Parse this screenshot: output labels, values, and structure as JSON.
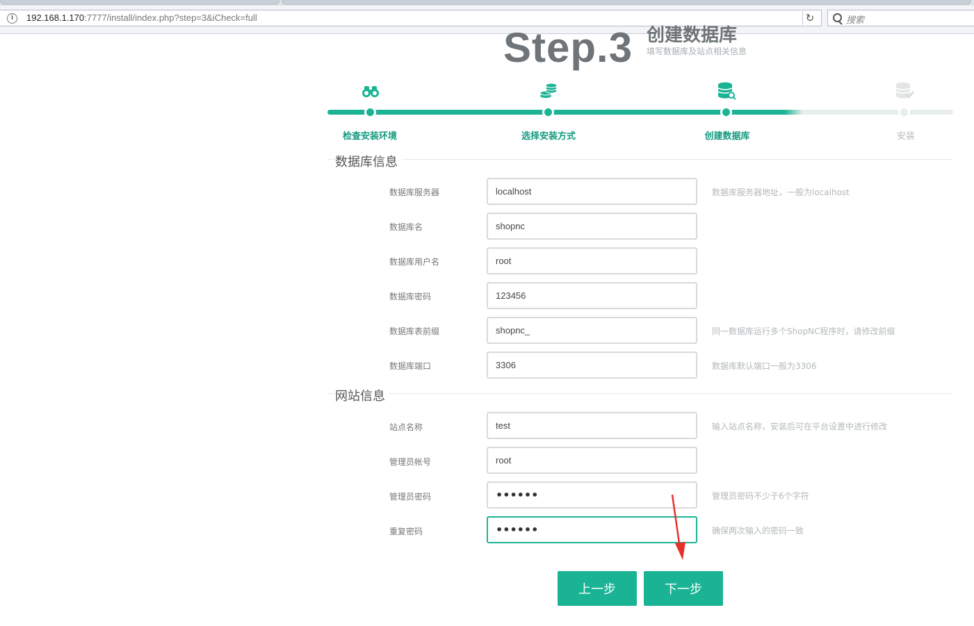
{
  "browser": {
    "url_host": "192.168.1.170",
    "url_rest": ":7777/install/index.php?step=3&iCheck=full",
    "search_placeholder": "搜索"
  },
  "header": {
    "step_big": "Step.3",
    "title": "创建数据库",
    "desc": "填写数据库及站点相关信息"
  },
  "steps": [
    {
      "label": "检查安装环境",
      "icon": "binoculars-icon",
      "done": true
    },
    {
      "label": "选择安装方式",
      "icon": "coins-icon",
      "done": true
    },
    {
      "label": "创建数据库",
      "icon": "database-key-icon",
      "done": true
    },
    {
      "label": "安装",
      "icon": "database-check-icon",
      "done": false
    }
  ],
  "db_section": {
    "title": "数据库信息",
    "fields": [
      {
        "label": "数据库服务器",
        "value": "localhost",
        "hint": "数据库服务器地址，一般为localhost"
      },
      {
        "label": "数据库名",
        "value": "shopnc",
        "hint": ""
      },
      {
        "label": "数据库用户名",
        "value": "root",
        "hint": ""
      },
      {
        "label": "数据库密码",
        "value": "123456",
        "hint": ""
      },
      {
        "label": "数据库表前缀",
        "value": "shopnc_",
        "hint": "同一数据库运行多个ShopNC程序时，请修改前缀"
      },
      {
        "label": "数据库端口",
        "value": "3306",
        "hint": "数据库默认端口一般为3306"
      }
    ]
  },
  "site_section": {
    "title": "网站信息",
    "fields": [
      {
        "label": "站点名称",
        "value": "test",
        "hint": "输入站点名称，安装后可在平台设置中进行修改"
      },
      {
        "label": "管理员帐号",
        "value": "root",
        "hint": ""
      },
      {
        "label": "管理员密码",
        "value": "••••••",
        "hint": "管理员密码不少于6个字符"
      },
      {
        "label": "重复密码",
        "value": "••••••",
        "hint": "确保两次输入的密码一致"
      }
    ]
  },
  "buttons": {
    "prev": "上一步",
    "next": "下一步"
  },
  "colors": {
    "accent": "#1ab394",
    "annotation_arrow": "#e8312a"
  }
}
